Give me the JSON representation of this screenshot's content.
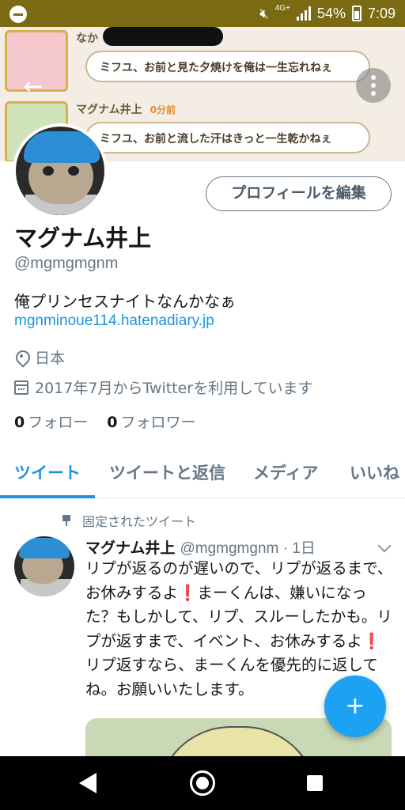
{
  "status_bar": {
    "network_label": "4G+",
    "battery_text": "54%",
    "time": "7:09"
  },
  "banner": {
    "rows": [
      {
        "name": "なか",
        "time": "",
        "message": "ミフユ、お前と見た夕焼けを俺は一生忘れねぇ"
      },
      {
        "name": "マグナム井上",
        "time": "0分前",
        "message": "ミフユ、お前と流した汗はきっと一生乾かねぇ"
      }
    ],
    "back_icon": "arrow-left-icon",
    "more_icon": "more-vertical-icon"
  },
  "profile": {
    "edit_button_label": "プロフィールを編集",
    "display_name": "マグナム井上",
    "handle": "@mgmgmgnm",
    "bio": "俺プリンセスナイトなんかなぁ",
    "website": "mgnminoue114.hatenadiary.jp",
    "location": "日本",
    "joined": "2017年7月からTwitterを利用しています",
    "following_count": "0",
    "following_label": "フォロー",
    "followers_count": "0",
    "followers_label": "フォロワー"
  },
  "tabs": [
    {
      "label": "ツイート"
    },
    {
      "label": "ツイートと返信"
    },
    {
      "label": "メディア"
    },
    {
      "label": "いいね"
    }
  ],
  "pinned_tweet": {
    "pinned_label": "固定されたツイート",
    "author_name": "マグナム井上",
    "author_handle": "@mgmgmgnm",
    "separator": " · ",
    "time": "1日",
    "text_parts": [
      "リプが返るのが遅いので、リプが返るまで、お休みするよ",
      "❗",
      "まーくんは、嫌いになった？もしかして、リプ、スルーしたかも。リプが返すまで、イベント、お休みするよ",
      "❗",
      "リプ返すなら、まーくんを優先的に返してね。お願いいたします。"
    ]
  },
  "fab": {
    "icon": "compose-feather-icon",
    "symbol": "+"
  },
  "colors": {
    "accent": "#1b95e0",
    "fab": "#1da1f2",
    "status_bar": "#7a6a12",
    "secondary_text": "#657786"
  }
}
